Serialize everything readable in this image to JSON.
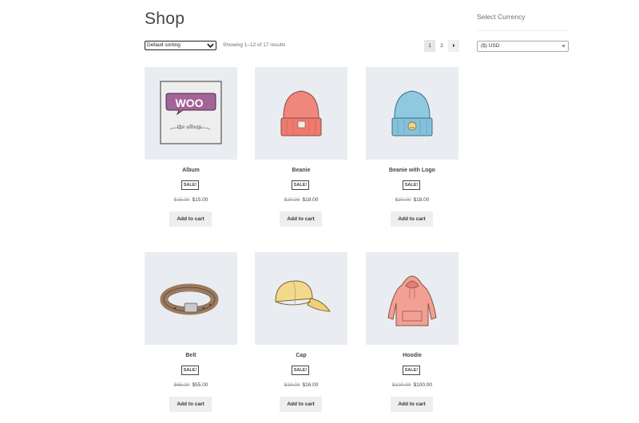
{
  "page_title": "Shop",
  "toolbar": {
    "sorting_value": "Default sorting",
    "result_count": "Showing 1–12 of 17 results",
    "pages": [
      "1",
      "2"
    ],
    "current_page": "1"
  },
  "products": [
    {
      "name": "Album",
      "badge": "SALE!",
      "old_price": "$15.00",
      "price": "$15.00",
      "button": "Add to cart",
      "icon": "album-icon"
    },
    {
      "name": "Beanie",
      "badge": "SALE!",
      "old_price": "$20.00",
      "price": "$18.00",
      "button": "Add to cart",
      "icon": "beanie-icon"
    },
    {
      "name": "Beanie with Logo",
      "badge": "SALE!",
      "old_price": "$20.00",
      "price": "$18.00",
      "button": "Add to cart",
      "icon": "beanie-logo-icon"
    },
    {
      "name": "Belt",
      "badge": "SALE!",
      "old_price": "$65.00",
      "price": "$55.00",
      "button": "Add to cart",
      "icon": "belt-icon"
    },
    {
      "name": "Cap",
      "badge": "SALE!",
      "old_price": "$18.00",
      "price": "$16.00",
      "button": "Add to cart",
      "icon": "cap-icon"
    },
    {
      "name": "Hoodie",
      "badge": "SALE!",
      "old_price": "$100.00",
      "price": "$100.00",
      "button": "Add to cart",
      "icon": "hoodie-icon"
    }
  ],
  "album_art": {
    "logo_text": "WOO",
    "caption": "the album"
  },
  "sidebar": {
    "widget_title": "Select Currency",
    "currency_value": "($) USD"
  },
  "colors": {
    "text": "#43454b",
    "thumb_bg": "#e9edf2",
    "button_bg": "#eeeeee",
    "current_page_bg": "#e6e6e6"
  }
}
